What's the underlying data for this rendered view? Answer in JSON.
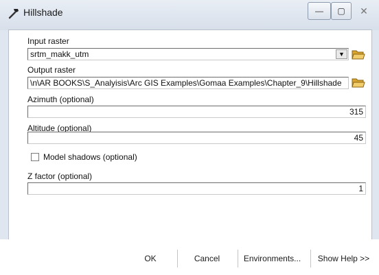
{
  "window": {
    "title": "Hillshade",
    "minimize_label": "—",
    "maximize_label": "▢",
    "close_label": "✕"
  },
  "form": {
    "input_raster": {
      "label": "Input raster",
      "value": "srtm_makk_utm"
    },
    "output_raster": {
      "label": "Output raster",
      "value": "\\n\\AR BOOKS\\S_Analyisis\\Arc GIS Examples\\Gomaa Examples\\Chapter_9\\Hillshade"
    },
    "azimuth": {
      "label": "Azimuth (optional)",
      "value": "315"
    },
    "altitude": {
      "label": "Altitude (optional)",
      "value": "45"
    },
    "model_shadows": {
      "label": "Model shadows (optional)",
      "checked": false
    },
    "z_factor": {
      "label": "Z factor (optional)",
      "value": "1"
    }
  },
  "buttons": {
    "ok": "OK",
    "cancel": "Cancel",
    "environments": "Environments...",
    "show_help": "Show Help >>"
  },
  "icons": {
    "title": "hammer-icon",
    "browse": "open-folder-icon"
  },
  "colors": {
    "window_bg": "#dfe6ef",
    "panel_bg": "#ffffff",
    "folder_yellow": "#e8b94a"
  }
}
